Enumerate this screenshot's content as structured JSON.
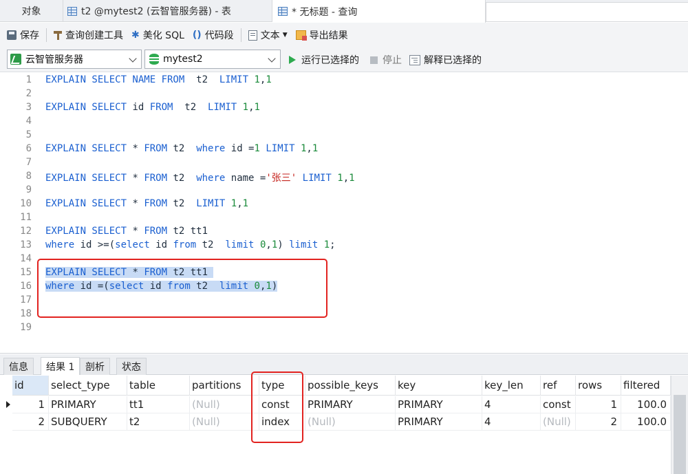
{
  "tabs": [
    {
      "label": "对象"
    },
    {
      "label": "t2 @mytest2 (云智管服务器) - 表"
    },
    {
      "label": "* 无标题 - 查询"
    }
  ],
  "toolbar": {
    "save": "保存",
    "query_builder": "查询创建工具",
    "beautify": "美化 SQL",
    "snippet": "代码段",
    "text": "文本",
    "export": "导出结果"
  },
  "connection": {
    "server": "云智管服务器",
    "database": "mytest2",
    "run_selected": "运行已选择的",
    "stop": "停止",
    "explain_selected": "解释已选择的"
  },
  "editor": {
    "line_numbers": [
      "1",
      "2",
      "3",
      "4",
      "5",
      "6",
      "7",
      "8",
      "9",
      "10",
      "11",
      "12",
      "13",
      "14",
      "15",
      "16",
      "17",
      "18",
      "19"
    ]
  },
  "result_tabs": [
    "信息",
    "结果 1",
    "剖析",
    "状态"
  ],
  "grid": {
    "columns": [
      "id",
      "select_type",
      "table",
      "partitions",
      "type",
      "possible_keys",
      "key",
      "key_len",
      "ref",
      "rows",
      "filtered"
    ],
    "rows": [
      [
        "1",
        "PRIMARY",
        "tt1",
        "(Null)",
        "const",
        "PRIMARY",
        "PRIMARY",
        "4",
        "const",
        "1",
        "100.0"
      ],
      [
        "2",
        "SUBQUERY",
        "t2",
        "(Null)",
        "index",
        "(Null)",
        "PRIMARY",
        "4",
        "(Null)",
        "2",
        "100.0"
      ]
    ]
  },
  "colors": {
    "keyword": "#1a5fd0",
    "number": "#1a8a3a",
    "string": "#c4221c",
    "selection": "#c8dbf5",
    "highlight_box": "#e2221f"
  }
}
